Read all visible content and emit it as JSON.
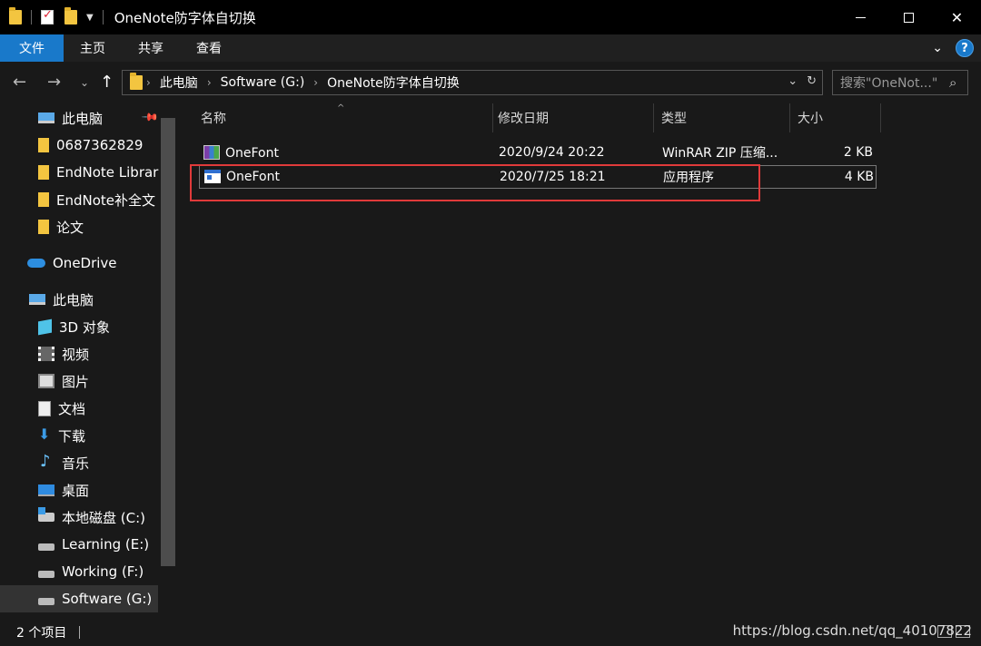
{
  "window": {
    "title": "OneNote防字体自切换",
    "controls": {
      "minimize": "",
      "maximize": "",
      "close": "✕"
    }
  },
  "ribbon": {
    "tabs": [
      "文件",
      "主页",
      "共享",
      "查看"
    ],
    "help": "?"
  },
  "address": {
    "breadcrumbs": [
      "此电脑",
      "Software (G:)",
      "OneNote防字体自切换"
    ]
  },
  "search": {
    "placeholder": "搜索\"OneNot...\""
  },
  "sidebar": {
    "items": [
      {
        "label": "此电脑",
        "icon": "pc-icon"
      },
      {
        "label": "0687362829",
        "icon": "folder-icon"
      },
      {
        "label": "EndNote Librar",
        "icon": "folder-icon"
      },
      {
        "label": "EndNote补全文",
        "icon": "folder-icon"
      },
      {
        "label": "论文",
        "icon": "folder-icon"
      },
      {
        "label": "OneDrive",
        "icon": "cloud-icon"
      },
      {
        "label": "此电脑",
        "icon": "pc-icon"
      },
      {
        "label": "3D 对象",
        "icon": "cube-icon"
      },
      {
        "label": "视频",
        "icon": "film-icon"
      },
      {
        "label": "图片",
        "icon": "picture-icon"
      },
      {
        "label": "文档",
        "icon": "document-icon"
      },
      {
        "label": "下载",
        "icon": "download-icon"
      },
      {
        "label": "音乐",
        "icon": "music-icon"
      },
      {
        "label": "桌面",
        "icon": "desktop-icon"
      },
      {
        "label": "本地磁盘 (C:)",
        "icon": "system-drive-icon"
      },
      {
        "label": "Learning (E:)",
        "icon": "drive-icon"
      },
      {
        "label": "Working (F:)",
        "icon": "drive-icon"
      },
      {
        "label": "Software (G:)",
        "icon": "drive-icon"
      }
    ]
  },
  "filelist": {
    "columns": [
      "名称",
      "修改日期",
      "类型",
      "大小"
    ],
    "rows": [
      {
        "name": "OneFont",
        "date": "2020/9/24 20:22",
        "type": "WinRAR ZIP 压缩...",
        "size": "2 KB",
        "icon": "rar-archive-icon"
      },
      {
        "name": "OneFont",
        "date": "2020/7/25 18:21",
        "type": "应用程序",
        "size": "4 KB",
        "icon": "application-icon"
      }
    ]
  },
  "status": {
    "item_count": "2 个项目",
    "watermark": "https://blog.csdn.net/qq_40107822"
  },
  "colors": {
    "accent": "#1979ca",
    "highlight_box": "#e03a3a",
    "folder": "#f3c540"
  }
}
